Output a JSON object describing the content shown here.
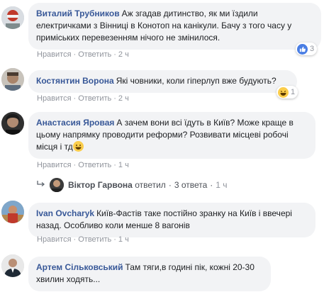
{
  "comments": [
    {
      "author": "Виталий Трубников",
      "text": "Аж згадав дитинство, як ми їздили електричками з Вінниці в Конотоп на канікули. Бачу з того часу у приміських перевезенням нічого не змінилося.",
      "like_label": "Нравится",
      "reply_label": "Ответить",
      "time": "2 ч",
      "reaction_type": "like-icon",
      "reaction_count": "3"
    },
    {
      "author": "Костянтин Ворона",
      "text": "Які човники, коли гіперлуп вже будують?",
      "like_label": "Нравится",
      "reply_label": "Ответить",
      "time": "2 ч",
      "reaction_type": "haha-icon",
      "reaction_count": "1"
    },
    {
      "author": "Анастасия Яровая",
      "text": "А зачем вони всі їдуть в Київ? Може краще в цьому напрямку проводити реформи? Розвивати місцеві робочі місця і тд",
      "like_label": "Нравится",
      "reply_label": "Ответить",
      "time": "1 ч"
    },
    {
      "author": "Ivan Ovcharyk",
      "text": "Київ-Фастів таке постійно зранку на Київ і ввечері назад. Особливо коли менше 8 вагонів",
      "like_label": "Нравится",
      "reply_label": "Ответить",
      "time": "1 ч"
    },
    {
      "author": "Артем Сільковський",
      "text": "Там тяги,в годині пік, кожні 20-30 хвилин ходять..."
    }
  ],
  "replies_summary": {
    "name": "Віктор Гарвона",
    "action": "ответил",
    "count": "3 ответа",
    "time": "1 ч"
  },
  "separator": "·",
  "colors": {
    "author": "#385898",
    "bubble": "#f2f3f5",
    "meta": "#90949c",
    "like": "#4a7ee4",
    "haha": "#fbcd4b"
  }
}
